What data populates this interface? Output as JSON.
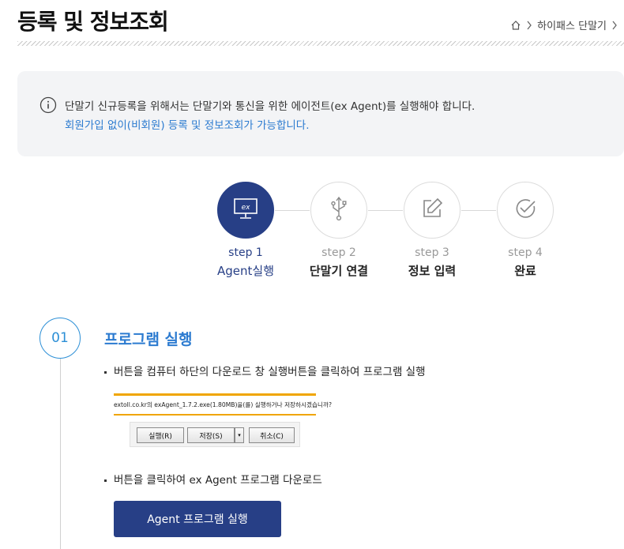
{
  "page": {
    "title": "등록 및 정보조회"
  },
  "breadcrumb": {
    "home_icon": "home-icon",
    "item": "하이패스 단말기"
  },
  "notice": {
    "icon": "info-icon",
    "line1": "단말기 신규등록을 위해서는 단말기와 통신을 위한 에이전트(ex Agent)를 실행해야 합니다.",
    "line2": "회원가입 없이(비회원) 등록 및 정보조회가 가능합니다."
  },
  "steps": [
    {
      "num": "step 1",
      "label": "Agent실행",
      "icon": "monitor-ex-icon",
      "active": true
    },
    {
      "num": "step 2",
      "label": "단말기 연결",
      "icon": "usb-icon",
      "active": false
    },
    {
      "num": "step 3",
      "label": "정보 입력",
      "icon": "edit-icon",
      "active": false
    },
    {
      "num": "step 4",
      "label": "완료",
      "icon": "check-circle-icon",
      "active": false
    }
  ],
  "section": {
    "number": "01",
    "title": "프로그램 실행",
    "bullet1": "버튼을 컴퓨터 하단의 다운로드 창 실행버튼을 클릭하여 프로그램 실행",
    "dialog": {
      "message": "extoll.co.kr의 exAgent_1.7.2.exe(1.80MB)을(를) 실행하거나 저장하시겠습니까?",
      "run": "실행(R)",
      "save": "저장(S)",
      "arrow": "▾",
      "cancel": "취소(C)"
    },
    "bullet2": "버튼을 클릭하여 ex Agent 프로그램 다운로드",
    "button": "Agent 프로그램 실행"
  },
  "colors": {
    "primary": "#273f86",
    "accent": "#2c7bd0",
    "warning": "#f0a500"
  }
}
